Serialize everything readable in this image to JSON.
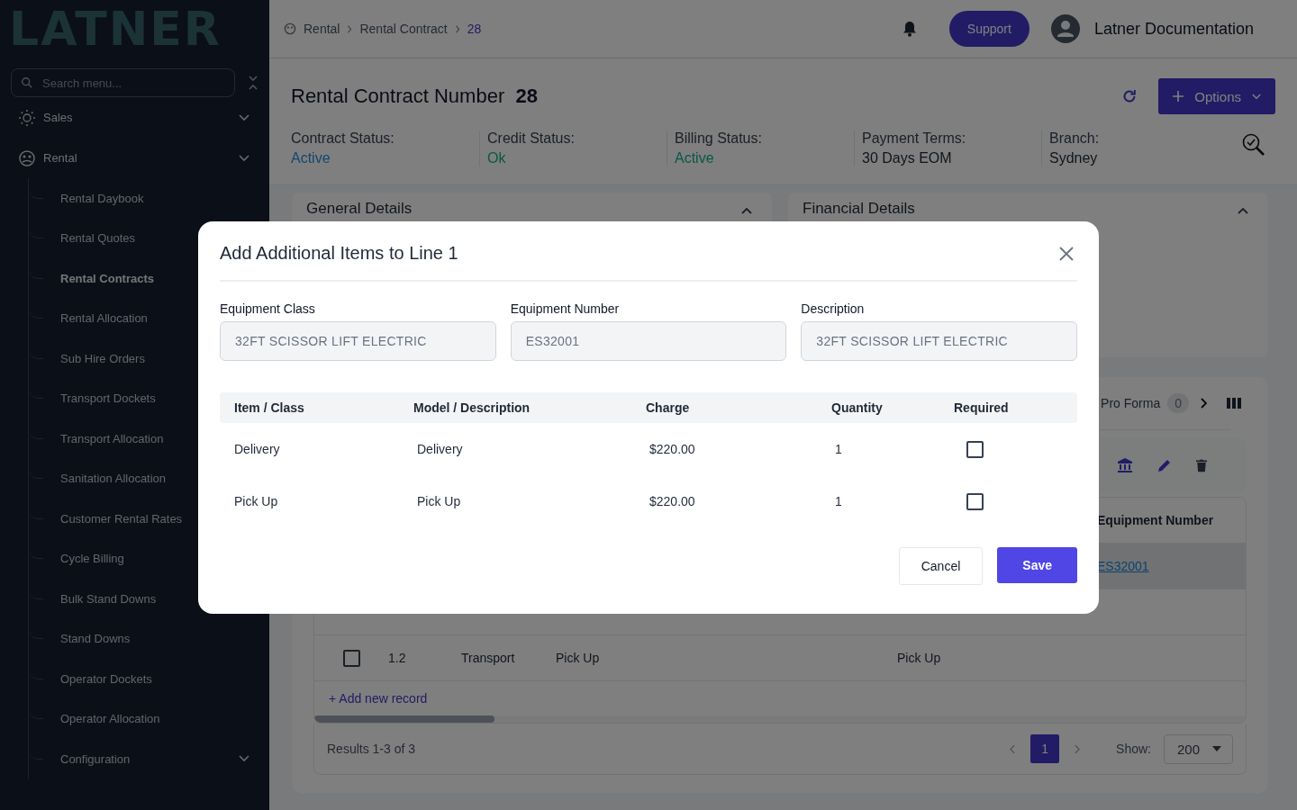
{
  "sidebar": {
    "logo": "LATNER",
    "search": {
      "placeholder": "Search menu..."
    },
    "items": [
      {
        "label": "Sales"
      },
      {
        "label": "Rental",
        "children": [
          {
            "label": "Rental Daybook",
            "kind": "link",
            "selected": false
          },
          {
            "label": "Rental Quotes",
            "kind": "link",
            "selected": false
          },
          {
            "label": "Rental Contracts",
            "kind": "link",
            "selected": true
          },
          {
            "label": "Rental Allocation",
            "kind": "link",
            "selected": false
          },
          {
            "label": "Sub Hire Orders",
            "kind": "link",
            "selected": false
          },
          {
            "label": "Transport Dockets",
            "kind": "link",
            "selected": false
          },
          {
            "label": "Transport Allocation",
            "kind": "link",
            "selected": false
          },
          {
            "label": "Sanitation Allocation",
            "kind": "link",
            "selected": false
          },
          {
            "label": "Customer Rental Rates",
            "kind": "link",
            "selected": false
          },
          {
            "label": "Cycle Billing",
            "kind": "link",
            "selected": false
          },
          {
            "label": "Bulk Stand Downs",
            "kind": "link",
            "selected": false
          },
          {
            "label": "Stand Downs",
            "kind": "link",
            "selected": false
          },
          {
            "label": "Operator Dockets",
            "kind": "link",
            "selected": false
          },
          {
            "label": "Operator Allocation",
            "kind": "link",
            "selected": false
          },
          {
            "label": "Configuration",
            "kind": "group",
            "selected": false
          }
        ]
      }
    ]
  },
  "header": {
    "breadcrumb": [
      {
        "label": "Rental",
        "current": false
      },
      {
        "label": "Rental Contract",
        "current": false
      },
      {
        "label": "28",
        "current": true
      }
    ],
    "support": "Support",
    "user": "Latner Documentation"
  },
  "contract": {
    "title": "Rental Contract Number",
    "number": "28",
    "options": "Options",
    "fields": [
      {
        "label": "Contract Status:",
        "value": "Active",
        "kind": "link"
      },
      {
        "label": "Credit Status:",
        "value": "Ok",
        "kind": "status"
      },
      {
        "label": "Billing Status:",
        "value": "Active",
        "kind": "status"
      },
      {
        "label": "Payment Terms:",
        "value": "30 Days EOM",
        "kind": "text"
      },
      {
        "label": "Branch:",
        "value": "Sydney",
        "kind": "text"
      }
    ]
  },
  "cards": [
    {
      "title": "General Details",
      "expanded": true
    },
    {
      "title": "Financial Details",
      "expanded": true
    }
  ],
  "lines": {
    "tab": {
      "label": "Pro Forma",
      "badge": "0"
    },
    "columns": [
      {
        "label": "Equipment Number"
      }
    ],
    "rows": [
      {
        "selected": true,
        "equipment_number": "ES32001"
      },
      {
        "selected": false,
        "checked": false,
        "line": "1.2",
        "type": "Transport",
        "item": "Pick Up",
        "description": "Pick Up"
      }
    ],
    "add_record": "+ Add new record",
    "results": "Results 1-3 of 3",
    "page": "1",
    "show_label": "Show:",
    "page_size": "200"
  },
  "modal": {
    "title": "Add Additional Items to Line 1",
    "fields": [
      {
        "label": "Equipment Class",
        "value": "32FT SCISSOR LIFT ELECTRIC"
      },
      {
        "label": "Equipment Number",
        "value": "ES32001"
      },
      {
        "label": "Description",
        "value": "32FT SCISSOR LIFT ELECTRIC"
      }
    ],
    "columns": [
      "Item / Class",
      "Model / Description",
      "Charge",
      "Quantity",
      "Required"
    ],
    "rows": [
      {
        "item": "Delivery",
        "model": "Delivery",
        "charge": "$220.00",
        "quantity": "1",
        "required": false
      },
      {
        "item": "Pick Up",
        "model": "Pick Up",
        "charge": "$220.00",
        "quantity": "1",
        "required": false
      }
    ],
    "cancel": "Cancel",
    "save": "Save"
  }
}
